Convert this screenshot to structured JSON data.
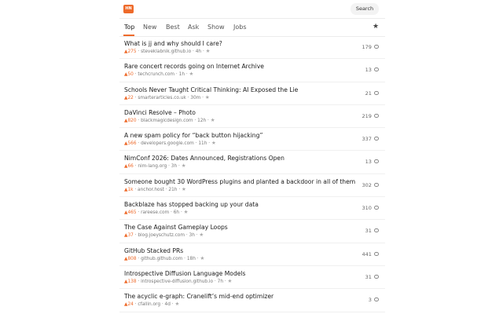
{
  "header": {
    "logo": "HN",
    "search_label": "Search"
  },
  "tabs": [
    "Top",
    "New",
    "Best",
    "Ask",
    "Show",
    "Jobs"
  ],
  "colors": {
    "accent": "#ee6a2a"
  },
  "icons": {
    "favorites": "star-icon",
    "comments": "comment-bubble-icon"
  },
  "stories": [
    {
      "title": "What is jj and why should I care?",
      "points": "▲275",
      "domain": "steveklabnik.github.io",
      "age": "4h",
      "comments": "179"
    },
    {
      "title": "Rare concert records going on Internet Archive",
      "points": "▲50",
      "domain": "techcrunch.com",
      "age": "1h",
      "comments": "13"
    },
    {
      "title": "Schools Never Taught Critical Thinking: AI Exposed the Lie",
      "points": "▲22",
      "domain": "smarterarticles.co.uk",
      "age": "30m",
      "comments": "21"
    },
    {
      "title": "DaVinci Resolve – Photo",
      "points": "▲820",
      "domain": "blackmagicdesign.com",
      "age": "12h",
      "comments": "219"
    },
    {
      "title": "A new spam policy for “back button hijacking”",
      "points": "▲566",
      "domain": "developers.google.com",
      "age": "11h",
      "comments": "337"
    },
    {
      "title": "NimConf 2026: Dates Announced, Registrations Open",
      "points": "▲66",
      "domain": "nim-lang.org",
      "age": "3h",
      "comments": "13"
    },
    {
      "title": "Someone bought 30 WordPress plugins and planted a backdoor in all of them",
      "points": "▲1k",
      "domain": "anchor.host",
      "age": "21h",
      "comments": "302"
    },
    {
      "title": "Backblaze has stopped backing up your data",
      "points": "▲465",
      "domain": "rareese.com",
      "age": "6h",
      "comments": "310"
    },
    {
      "title": "The Case Against Gameplay Loops",
      "points": "▲37",
      "domain": "blog.joeyschutz.com",
      "age": "3h",
      "comments": "31"
    },
    {
      "title": "GitHub Stacked PRs",
      "points": "▲808",
      "domain": "github.github.com",
      "age": "18h",
      "comments": "441"
    },
    {
      "title": "Introspective Diffusion Language Models",
      "points": "▲138",
      "domain": "introspective-diffusion.github.io",
      "age": "7h",
      "comments": "31"
    },
    {
      "title": "The acyclic e-graph: Cranelift’s mid-end optimizer",
      "points": "▲24",
      "domain": "cfallin.org",
      "age": "4d",
      "comments": "3"
    }
  ]
}
